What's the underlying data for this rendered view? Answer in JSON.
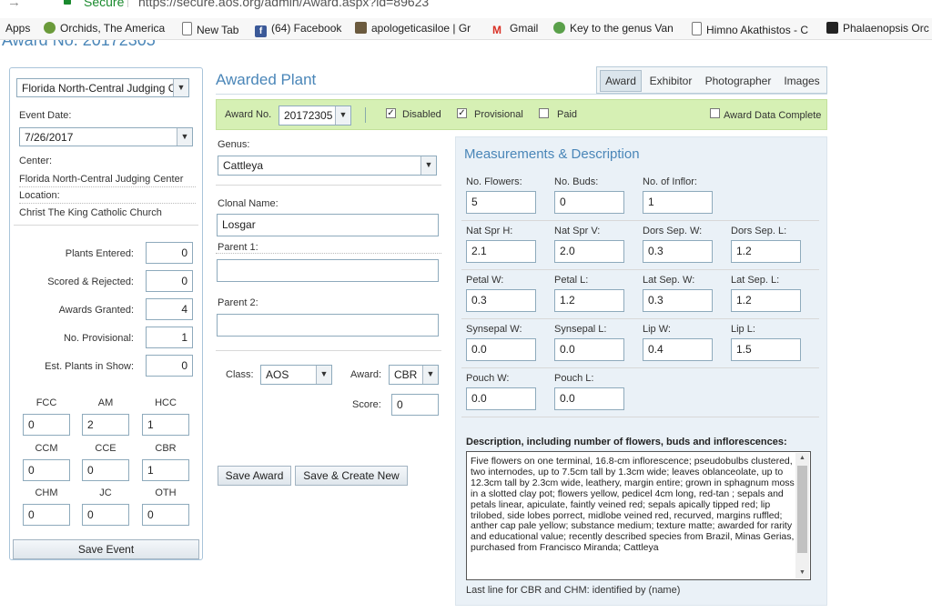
{
  "browser": {
    "secure_label": "Secure",
    "url": "https://secure.aos.org/admin/Award.aspx?id=89623",
    "bookmarks": [
      "Apps",
      "Orchids, The America",
      "New Tab",
      "(64) Facebook",
      "apologeticasiloe | Gr",
      "Gmail",
      "Key to the genus Van",
      "Himno Akathistos - C",
      "Phalaenopsis Orc"
    ]
  },
  "page": {
    "heading_partial": "Award No. 20172305"
  },
  "left": {
    "center_select": "Florida North-Central Judging C",
    "event_date_label": "Event Date:",
    "event_date": "7/26/2017",
    "center_label": "Center:",
    "center_value": "Florida North-Central Judging Center",
    "location_label": "Location:",
    "location_value": "Christ The King Catholic Church",
    "stats": [
      {
        "label": "Plants Entered:",
        "value": "0"
      },
      {
        "label": "Scored & Rejected:",
        "value": "0"
      },
      {
        "label": "Awards Granted:",
        "value": "4"
      },
      {
        "label": "No. Provisional:",
        "value": "1"
      },
      {
        "label": "Est. Plants in Show:",
        "value": "0"
      }
    ],
    "award_counts": [
      {
        "label": "FCC",
        "value": "0"
      },
      {
        "label": "AM",
        "value": "2"
      },
      {
        "label": "HCC",
        "value": "1"
      },
      {
        "label": "CCM",
        "value": "0"
      },
      {
        "label": "CCE",
        "value": "0"
      },
      {
        "label": "CBR",
        "value": "1"
      },
      {
        "label": "CHM",
        "value": "0"
      },
      {
        "label": "JC",
        "value": "0"
      },
      {
        "label": "OTH",
        "value": "0"
      }
    ],
    "save_event": "Save Event"
  },
  "main": {
    "title": "Awarded Plant",
    "tabs": [
      "Award",
      "Exhibitor",
      "Photographer",
      "Images"
    ],
    "active_tab": "Award",
    "award_no_label": "Award No.",
    "award_no": "20172305",
    "disabled_label": "Disabled",
    "provisional_label": "Provisional",
    "paid_label": "Paid",
    "complete_label": "Award Data Complete",
    "disabled_checked": true,
    "provisional_checked": true,
    "paid_checked": false,
    "complete_checked": false,
    "genus_label": "Genus:",
    "genus": "Cattleya",
    "clonal_label": "Clonal Name:",
    "clonal": "Losgar",
    "parent1_label": "Parent 1:",
    "parent1": "",
    "parent2_label": "Parent 2:",
    "parent2": "",
    "class_label": "Class:",
    "class_value": "AOS",
    "award_label": "Award:",
    "award_value": "CBR",
    "score_label": "Score:",
    "score": "0",
    "save_award": "Save Award",
    "save_create": "Save & Create New"
  },
  "measure": {
    "title": "Measurements & Description",
    "rows": [
      [
        {
          "label": "No. Flowers:",
          "value": "5"
        },
        {
          "label": "No. Buds:",
          "value": "0"
        },
        {
          "label": "No. of Inflor:",
          "value": "1"
        }
      ],
      [
        {
          "label": "Nat Spr H:",
          "value": "2.1"
        },
        {
          "label": "Nat Spr V:",
          "value": "2.0"
        },
        {
          "label": "Dors Sep. W:",
          "value": "0.3"
        },
        {
          "label": "Dors Sep. L:",
          "value": "1.2"
        }
      ],
      [
        {
          "label": "Petal W:",
          "value": "0.3"
        },
        {
          "label": "Petal L:",
          "value": "1.2"
        },
        {
          "label": "Lat Sep. W:",
          "value": "0.3"
        },
        {
          "label": "Lat Sep. L:",
          "value": "1.2"
        }
      ],
      [
        {
          "label": "Synsepal W:",
          "value": "0.0"
        },
        {
          "label": "Synsepal L:",
          "value": "0.0"
        },
        {
          "label": "Lip W:",
          "value": "0.4"
        },
        {
          "label": "Lip L:",
          "value": "1.5"
        }
      ],
      [
        {
          "label": "Pouch W:",
          "value": "0.0"
        },
        {
          "label": "Pouch L:",
          "value": "0.0"
        }
      ]
    ],
    "desc_label": "Description, including number of flowers, buds and inflorescences:",
    "description": "Five flowers on one terminal, 16.8-cm inflorescence; pseudobulbs clustered, two internodes, up to 7.5cm tall by 1.3cm wide; leaves oblanceolate, up to 12.3cm tall by 2.3cm wide, leathery, margin entire; grown in sphagnum moss in a slotted clay pot; flowers yellow, pedicel 4cm long, red-tan ; sepals and petals linear, apiculate, faintly veined red; sepals apically tipped red; lip trilobed, side lobes porrect, midlobe veined red, recurved, margins ruffled; anther cap pale yellow; substance medium; texture matte; awarded for rarity and educational value; recently described species from Brazil, Minas Gerias, purchased from Francisco Miranda; Cattleya",
    "footnote": "Last line for CBR and CHM: identified by (name)"
  }
}
